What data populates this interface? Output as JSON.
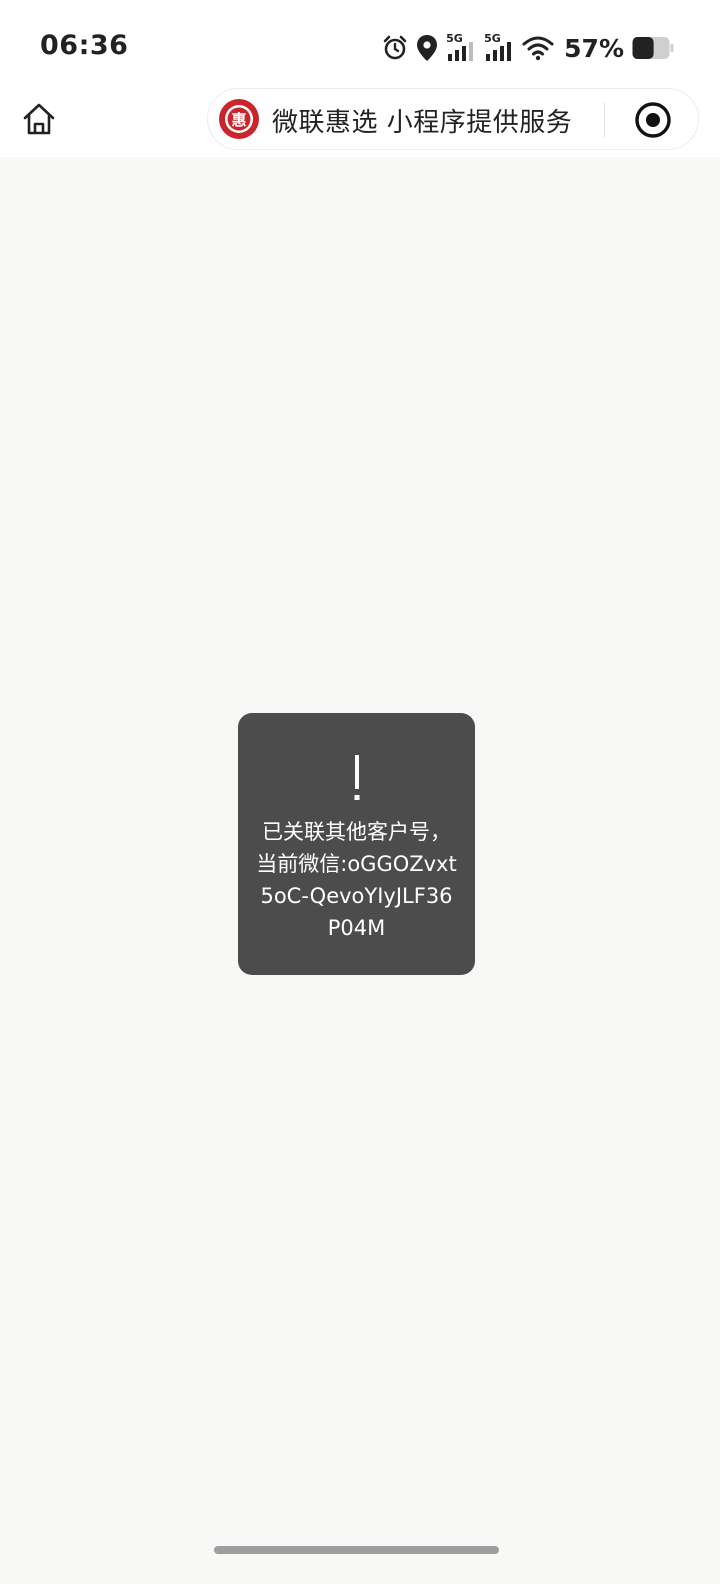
{
  "status_bar": {
    "time": "06:36",
    "network_1": "5G",
    "network_2": "5G",
    "battery_percent": "57%",
    "battery_level": 0.57
  },
  "nav": {
    "brand_title": "微联惠选 小程序提供服务",
    "logo_char": "惠",
    "icons": [
      "home-icon",
      "brand-logo",
      "close-target-icon"
    ]
  },
  "toast": {
    "icon": "exclamation-icon",
    "message": "已关联其他客户号，当前微信:oGGOZvxt5oC-QevoYIyJLF36P04M"
  },
  "colors": {
    "background": "#f8f8f7",
    "toast_bg": "#4c4c4c",
    "logo_red": "#c8262c"
  }
}
